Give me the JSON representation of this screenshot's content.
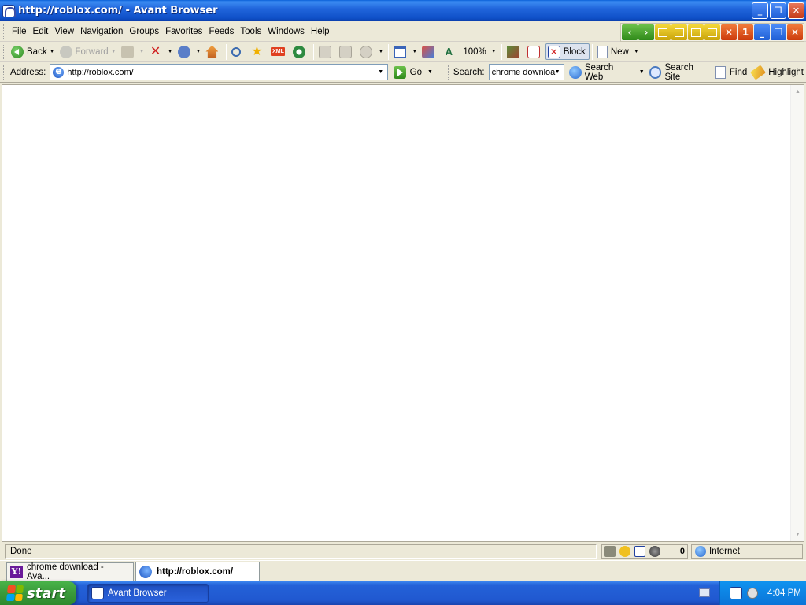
{
  "window": {
    "title": "http://roblox.com/ - Avant Browser",
    "controls": [
      "_",
      "❐",
      "✕"
    ]
  },
  "menu": {
    "items": [
      "File",
      "Edit",
      "View",
      "Navigation",
      "Groups",
      "Favorites",
      "Feeds",
      "Tools",
      "Windows",
      "Help"
    ],
    "tab_count": "1"
  },
  "toolbar": {
    "back": "Back",
    "forward": "Forward",
    "zoom": "100%",
    "block": "Block",
    "new": "New"
  },
  "address": {
    "label": "Address:",
    "url": "http://roblox.com/",
    "go": "Go",
    "search_label": "Search:",
    "search_value": "chrome downloa",
    "search_web": "Search Web",
    "search_site": "Search Site",
    "find": "Find",
    "highlight": "Highlight"
  },
  "status": {
    "text": "Done",
    "popup_count": "0",
    "zone": "Internet"
  },
  "tabs": [
    {
      "label": "chrome download - Ava..."
    },
    {
      "label": "http://roblox.com/"
    }
  ],
  "taskbar": {
    "start": "start",
    "task": "Avant Browser",
    "clock": "4:04 PM"
  }
}
